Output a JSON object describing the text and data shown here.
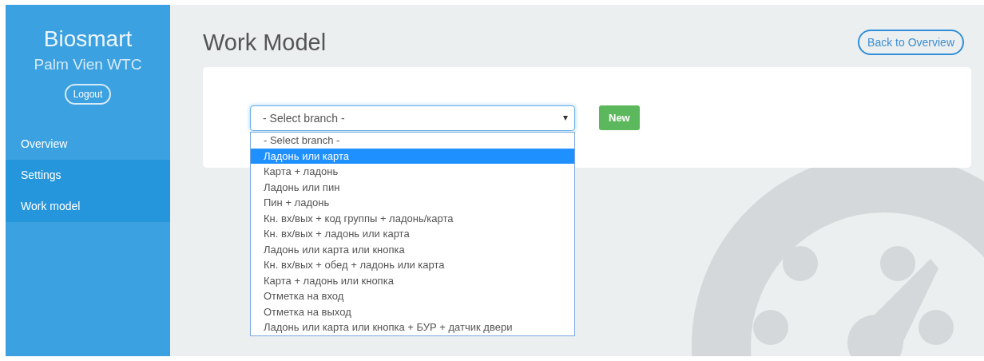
{
  "sidebar": {
    "brand": "Biosmart",
    "site": "Palm Vien WTC",
    "logout_button": "Logout",
    "items": [
      {
        "label": "Overview",
        "expanded": false
      },
      {
        "label": "Settings",
        "expanded": true,
        "children": [
          {
            "label": "Work model"
          }
        ]
      }
    ]
  },
  "page": {
    "title": "Work Model",
    "back_button": "Back to Overview"
  },
  "branch_select": {
    "value": "- Select branch -",
    "new_button": "New",
    "options": [
      {
        "label": "- Select branch -",
        "highlighted": false
      },
      {
        "label": "Ладонь или карта",
        "highlighted": true
      },
      {
        "label": "Карта + ладонь",
        "highlighted": false
      },
      {
        "label": "Ладонь или пин",
        "highlighted": false
      },
      {
        "label": "Пин + ладонь",
        "highlighted": false
      },
      {
        "label": "Кн. вх/вых + код группы + ладонь/карта",
        "highlighted": false
      },
      {
        "label": "Кн. вх/вых + ладонь или карта",
        "highlighted": false
      },
      {
        "label": "Ладонь или карта или кнопка",
        "highlighted": false
      },
      {
        "label": "Кн. вх/вых + обед + ладонь или карта",
        "highlighted": false
      },
      {
        "label": "Карта + ладонь или кнопка",
        "highlighted": false
      },
      {
        "label": "Отметка на вход",
        "highlighted": false
      },
      {
        "label": "Отметка на выход",
        "highlighted": false
      },
      {
        "label": "Ладонь или карта или кнопка + БУР + датчик двери",
        "highlighted": false
      }
    ]
  }
}
